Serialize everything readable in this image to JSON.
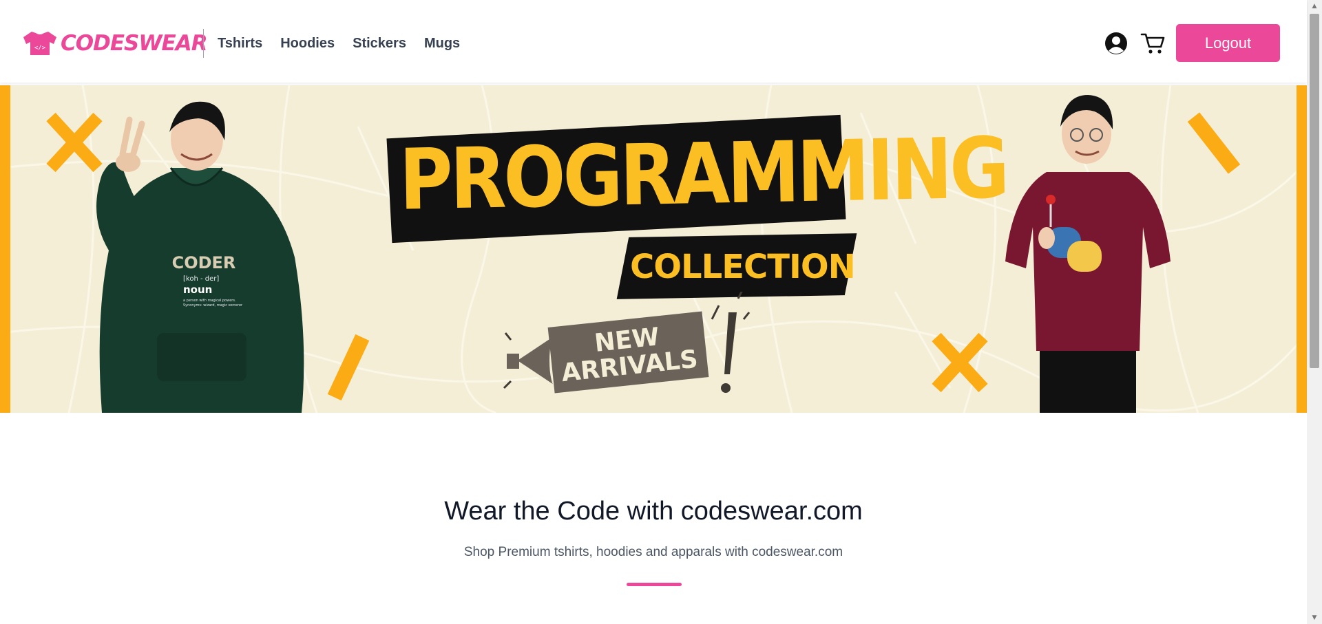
{
  "brand": {
    "name": "CODESWEAR",
    "color": "#ec4899",
    "logo_icon": "tshirt-code-icon"
  },
  "nav": {
    "items": [
      {
        "label": "Tshirts"
      },
      {
        "label": "Hoodies"
      },
      {
        "label": "Stickers"
      },
      {
        "label": "Mugs"
      }
    ]
  },
  "header_actions": {
    "account_icon": "user-circle-icon",
    "cart_icon": "shopping-cart-icon",
    "logout_label": "Logout"
  },
  "banner": {
    "title": "PROGRAMMING",
    "subtitle": "COLLECTION",
    "badge_line1": "NEW",
    "badge_line2": "ARRIVALS",
    "left_model": {
      "hoodie_word": "CODER",
      "hoodie_pron": "[koh - der]",
      "hoodie_pos": "noun",
      "hoodie_def": "a person with magical powers.",
      "hoodie_syn": "Synonyms: wizard, magic sorcerer"
    },
    "colors": {
      "accent": "#fbab14",
      "title": "#fbbf24",
      "background": "#f4eed6"
    }
  },
  "hero": {
    "heading": "Wear the Code with codeswear.com",
    "subheading": "Shop Premium tshirts, hoodies and apparals with codeswear.com",
    "accent": "#ec4899"
  }
}
